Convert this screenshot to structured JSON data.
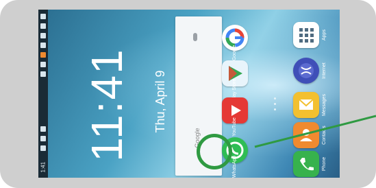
{
  "status_bar": {
    "time": "1:41"
  },
  "lock": {
    "clock": "11:41",
    "date": "Thu, April 9"
  },
  "search_widget": {
    "label": "Google"
  },
  "apps": [
    {
      "label": "Google",
      "icon": "google-icon",
      "color": "#ffffff"
    },
    {
      "label": "Play Store",
      "icon": "play-store-icon",
      "color": "#e8f4fb"
    },
    {
      "label": "YouTube",
      "icon": "youtube-icon",
      "color": "#e53935"
    },
    {
      "label": "WhatsApp",
      "icon": "whatsapp-icon",
      "color": "#2fbd54"
    },
    {
      "label": "Apps",
      "icon": "apps-grid-icon",
      "color": "#ffffff"
    },
    {
      "label": "Internet",
      "icon": "internet-icon",
      "color": "#3f4fb8"
    },
    {
      "label": "Messages",
      "icon": "messages-icon",
      "color": "#f3c02f"
    },
    {
      "label": "Contacts",
      "icon": "contacts-icon",
      "color": "#f08a2f"
    },
    {
      "label": "Phone",
      "icon": "phone-icon",
      "color": "#37b24d"
    }
  ],
  "highlight": {
    "color": "#2f9a42"
  }
}
